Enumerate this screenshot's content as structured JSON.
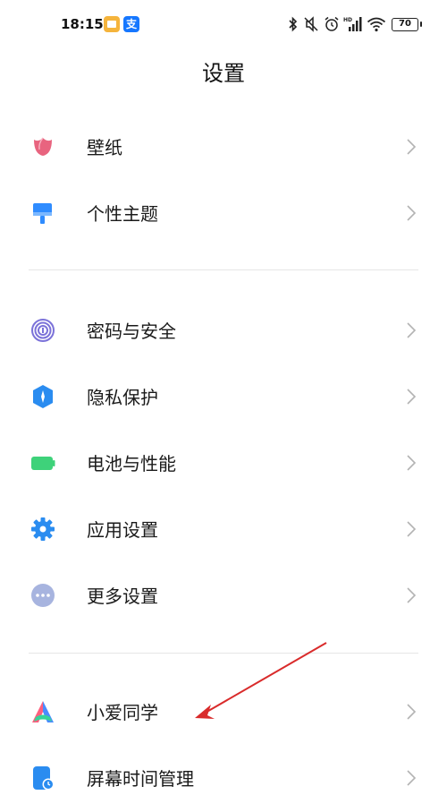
{
  "status_bar": {
    "time": "18:15",
    "battery": "70",
    "notification_icons": [
      "files-icon",
      "alipay-icon"
    ],
    "alipay_glyph": "支",
    "system_icons": [
      "bluetooth-icon",
      "mute-icon",
      "alarm-icon",
      "hd-signal-icon",
      "wifi-icon",
      "battery-icon"
    ]
  },
  "header": {
    "title": "设置"
  },
  "groups": [
    {
      "items": [
        {
          "label": "壁纸",
          "icon": "wallpaper-flower-icon"
        },
        {
          "label": "个性主题",
          "icon": "theme-brush-icon"
        }
      ]
    },
    {
      "items": [
        {
          "label": "密码与安全",
          "icon": "fingerprint-icon"
        },
        {
          "label": "隐私保护",
          "icon": "privacy-shield-icon"
        },
        {
          "label": "电池与性能",
          "icon": "battery-performance-icon"
        },
        {
          "label": "应用设置",
          "icon": "app-settings-gear-icon"
        },
        {
          "label": "更多设置",
          "icon": "more-settings-dots-icon"
        }
      ]
    },
    {
      "items": [
        {
          "label": "小爱同学",
          "icon": "xiaoai-assistant-icon"
        },
        {
          "label": "屏幕时间管理",
          "icon": "screen-time-icon"
        }
      ]
    }
  ],
  "colors": {
    "wallpaper": "#e8647f",
    "theme": "#2f8cff",
    "fingerprint": "#7b72d9",
    "privacy": "#2a8cf0",
    "battery": "#3ed27a",
    "gear": "#2a8cf0",
    "more": "#a7b4df",
    "screen_time": "#2a8cf0",
    "annotation_arrow": "#d92b2b"
  }
}
